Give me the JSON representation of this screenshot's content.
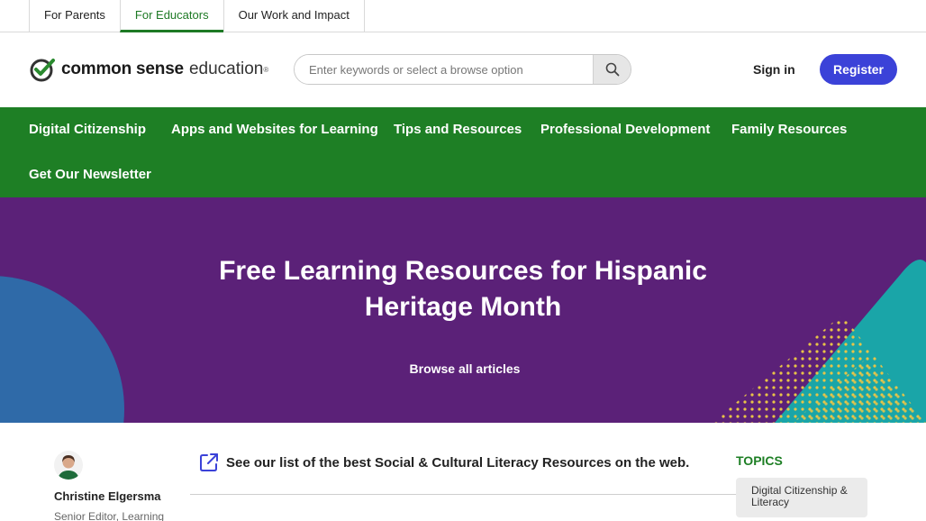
{
  "audience_tabs": [
    {
      "label": "For Parents",
      "active": false
    },
    {
      "label": "For Educators",
      "active": true
    },
    {
      "label": "Our Work and Impact",
      "active": false
    }
  ],
  "header": {
    "logo": {
      "brand": "common sense",
      "product": "education",
      "reg_mark": "®",
      "icon": "checkmark-circle-icon"
    },
    "search": {
      "placeholder": "Enter keywords or select a browse option",
      "value": "",
      "icon": "search-icon"
    },
    "signin_label": "Sign in",
    "register_label": "Register"
  },
  "main_nav": {
    "items": [
      {
        "label": "Digital Citizenship"
      },
      {
        "label": "Apps and Websites for Learning"
      },
      {
        "label": "Tips and Resources"
      },
      {
        "label": "Professional Development"
      },
      {
        "label": "Family Resources"
      },
      {
        "label": "Get Our Newsletter"
      }
    ]
  },
  "hero": {
    "title": "Free Learning Resources for Hispanic Heritage Month",
    "browse_link": "Browse all articles"
  },
  "article": {
    "author_name": "Christine Elgersma",
    "author_role": "Senior Editor, Learning",
    "see_list_text": "See our list of the best Social & Cultural Literacy Resources on the web.",
    "see_list_icon": "external-link-icon"
  },
  "topics": {
    "heading": "TOPICS",
    "items": [
      {
        "label": "Digital Citizenship & Literacy"
      }
    ]
  },
  "colors": {
    "brand_green": "#1e7f25",
    "hero_purple": "#5b2178",
    "register_blue": "#3b42d8",
    "teal": "#1aa5a8",
    "yellow_dots": "#e8c447",
    "blue_circle": "#2f6aa8"
  }
}
